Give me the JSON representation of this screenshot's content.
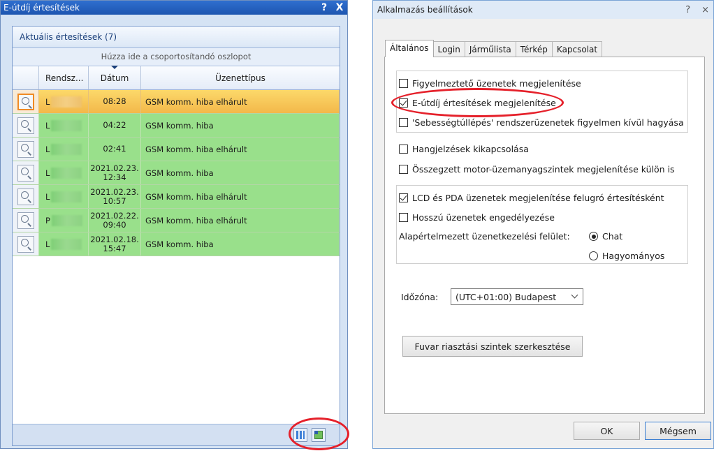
{
  "left_window": {
    "title": "E-útdíj értesítések",
    "help": "?",
    "close": "X",
    "panel_title": "Aktuális értesítések (7)",
    "group_hint": "Húzza ide a csoportosítandó oszlopot",
    "columns": {
      "reg": "Rendsz...",
      "date": "Dátum",
      "type": "Üzenettípus"
    },
    "rows": [
      {
        "reg": "L",
        "date1": "08:28",
        "date2": "",
        "type": "GSM komm. hiba elhárult"
      },
      {
        "reg": "L",
        "date1": "04:22",
        "date2": "",
        "type": "GSM komm. hiba"
      },
      {
        "reg": "L",
        "date1": "02:41",
        "date2": "",
        "type": "GSM komm. hiba elhárult"
      },
      {
        "reg": "L",
        "date1": "2021.02.23.",
        "date2": "12:34",
        "type": "GSM komm. hiba"
      },
      {
        "reg": "L",
        "date1": "2021.02.23.",
        "date2": "10:57",
        "type": "GSM komm. hiba elhárult"
      },
      {
        "reg": "P",
        "date1": "2021.02.22.",
        "date2": "09:40",
        "type": "GSM komm. hiba elhárult"
      },
      {
        "reg": "L",
        "date1": "2021.02.18.",
        "date2": "15:47",
        "type": "GSM komm. hiba"
      }
    ]
  },
  "right_window": {
    "title": "Alkalmazás beállítások",
    "help": "?",
    "close": "×",
    "tabs": [
      "Általános",
      "Login",
      "Járműlista",
      "Térkép",
      "Kapcsolat"
    ],
    "options": {
      "warn_msgs": {
        "label": "Figyelmeztető üzenetek megjelenítése",
        "checked": false
      },
      "etoll": {
        "label": "E-útdíj értesítések megjelenítése",
        "checked": true
      },
      "speeding": {
        "label": "'Sebességtúllépés' rendszerüzenetek figyelmen kívül hagyása",
        "checked": false
      },
      "sound_off": {
        "label": "Hangjelzések kikapcsolása",
        "checked": false
      },
      "fuel": {
        "label": "Összegzett motor-üzemanyagszintek megjelenítése külön is",
        "checked": false
      },
      "lcd_pda": {
        "label": "LCD és PDA üzenetek megjelenítése felugró értesítésként",
        "checked": true
      },
      "long_msgs": {
        "label": "Hosszú üzenetek engedélyezése",
        "checked": false
      }
    },
    "default_ui_label": "Alapértelmezett üzenetkezelési felület:",
    "radio_chat": "Chat",
    "radio_classic": "Hagyományos",
    "timezone_label": "Időzóna:",
    "timezone_value": "(UTC+01:00) Budapest",
    "edit_button": "Fuvar riasztási szintek szerkesztése",
    "ok": "OK",
    "cancel": "Mégsem"
  },
  "colors": {
    "row_green": "#99e08b",
    "row_selected": "#f3b84a",
    "highlight_red": "#e5202a",
    "title_blue": "#1d55b0"
  }
}
